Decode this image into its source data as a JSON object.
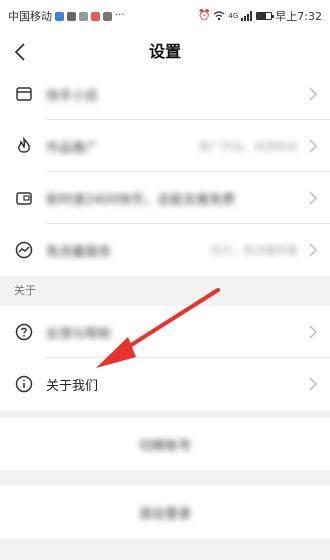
{
  "status_bar": {
    "carrier": "中国移动",
    "network": "4G",
    "time": "早上7:32",
    "more": "···"
  },
  "nav": {
    "title": "设置"
  },
  "rows_top": [
    {
      "label": "快手小店",
      "value": "",
      "icon": "store-icon"
    },
    {
      "label": "作品推广",
      "value": "推广作品，收获粉丝",
      "icon": "fire-icon"
    },
    {
      "label": "新时速2400快币，总能去推免费",
      "value": "",
      "icon": "wallet-card-icon"
    },
    {
      "label": "免流量服务",
      "value": "包月，免流量观看",
      "icon": "trend-circle-icon"
    }
  ],
  "section": {
    "about_header": "关于"
  },
  "rows_about": [
    {
      "label": "反馈与帮助",
      "icon": "question-circle-icon"
    },
    {
      "label": "关于我们",
      "icon": "info-circle-icon"
    }
  ],
  "buttons": {
    "switch_account": "切换账号",
    "logout": "退出登录"
  },
  "colors": {
    "arrow": "#e8322d",
    "background": "#f2f2f2"
  }
}
